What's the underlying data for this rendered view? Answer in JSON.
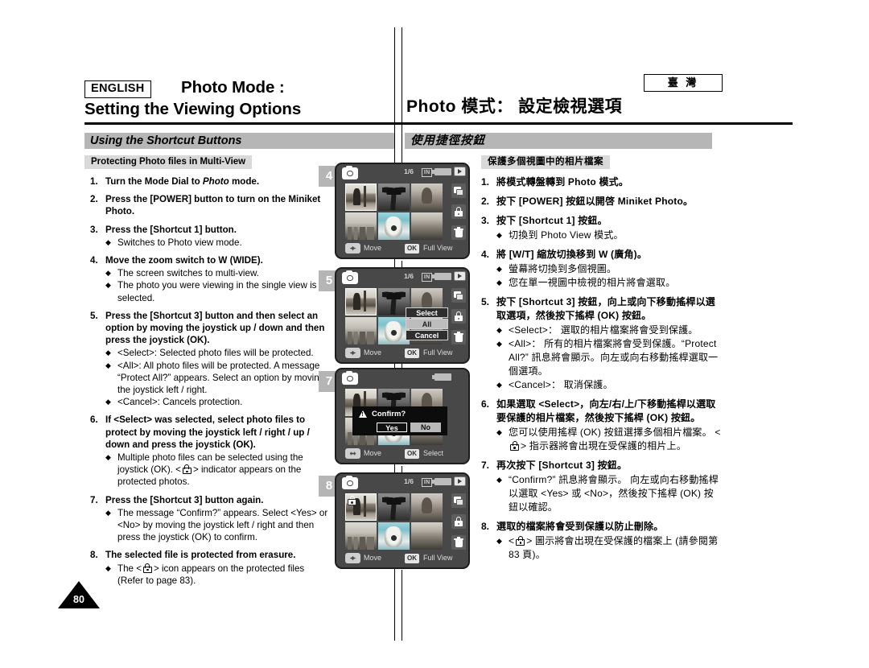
{
  "header": {
    "language_badge": "ENGLISH",
    "title_en_line1": "Photo Mode :",
    "title_en_line2": "Setting the Viewing Options",
    "title_cn": "Photo 模式： 設定檢視選項",
    "region_badge": "臺 灣"
  },
  "section": {
    "band_en": "Using the Shortcut Buttons",
    "band_cn": "使用捷徑按鈕",
    "chip_en": "Protecting Photo files in Multi-View",
    "chip_cn": "保護多個視圖中的相片檔案"
  },
  "steps_en": [
    {
      "num": "1.",
      "text": "Turn the Mode Dial to Photo mode.",
      "text_pre": "Turn the Mode Dial to ",
      "text_em": "Photo",
      "text_post": " mode.",
      "bullets": []
    },
    {
      "num": "2.",
      "text": "Press the [POWER] button to turn on the Miniket Photo.",
      "bullets": []
    },
    {
      "num": "3.",
      "text": "Press the [Shortcut 1] button.",
      "bullets": [
        "Switches to Photo view mode."
      ]
    },
    {
      "num": "4.",
      "text": "Move the zoom switch to W (WIDE).",
      "bullets": [
        "The screen switches to multi-view.",
        "The photo you were viewing in the single view is selected."
      ]
    },
    {
      "num": "5.",
      "text": "Press the [Shortcut 3] button and then select an option by moving the joystick up / down and then press the joystick (OK).",
      "bullets": [
        "<Select>: Selected photo files will be protected.",
        "<All>: All photo files will be protected. A message “Protect All?” appears. Select an option by moving the joystick left / right.",
        "<Cancel>: Cancels protection."
      ]
    },
    {
      "num": "6.",
      "text": "If <Select> was selected, select photo files to protect by moving the joystick left / right / up / down and press the joystick (OK).",
      "bullets": [
        "Multiple photo files can be selected using the joystick (OK). <  > indicator appears on the protected photos."
      ]
    },
    {
      "num": "7.",
      "text": "Press the [Shortcut 3] button again.",
      "bullets": [
        "The message “Confirm?” appears. Select <Yes> or <No> by moving the joystick left / right and then press the joystick (OK) to confirm."
      ]
    },
    {
      "num": "8.",
      "text": "The selected file is protected from erasure.",
      "bullets": [
        "The <  > icon appears on the protected files (Refer to page 83)."
      ]
    }
  ],
  "steps_cn": [
    {
      "num": "1.",
      "text": "將模式轉盤轉到 Photo 模式。",
      "bullets": []
    },
    {
      "num": "2.",
      "text": "按下 [POWER] 按鈕以開啓 Miniket Photo。",
      "bullets": []
    },
    {
      "num": "3.",
      "text": "按下 [Shortcut 1] 按鈕。",
      "bullets": [
        "切換到 Photo View 模式。"
      ]
    },
    {
      "num": "4.",
      "text": "將 [W/T] 縮放切換移到 W (廣角)。",
      "bullets": [
        "螢幕將切換到多個視圖。",
        "您在單一視圖中檢視的相片將會選取。"
      ]
    },
    {
      "num": "5.",
      "text": "按下 [Shortcut 3] 按鈕，向上或向下移動搖桿以選取選項，然後按下搖桿 (OK) 按鈕。",
      "bullets": [
        "<Select>： 選取的相片檔案將會受到保護。",
        "<All>： 所有的相片檔案將會受到保護。“Protect All?” 訊息將會顯示。向左或向右移動搖桿選取一個選項。",
        "<Cancel>： 取消保護。"
      ]
    },
    {
      "num": "6.",
      "text": "如果選取 <Select>，向左/右/上/下移動搖桿以選取要保護的相片檔案，然後按下搖桿 (OK) 按鈕。",
      "bullets": [
        "您可以使用搖桿 (OK) 按鈕選擇多個相片檔案。<  > 指示器將會出現在受保護的相片上。"
      ]
    },
    {
      "num": "7.",
      "text": "再次按下 [Shortcut 3] 按鈕。",
      "bullets": [
        "“Confirm?” 訊息將會顯示。 向左或向右移動搖桿以選取 <Yes> 或 <No>，然後按下搖桿 (OK) 按鈕以確認。"
      ]
    },
    {
      "num": "8.",
      "text": "選取的檔案將會受到保護以防止刪除。",
      "bullets": [
        "<  > 圖示將會出現在受保護的檔案上 (請參閱第 83 頁)。"
      ]
    }
  ],
  "screens": [
    {
      "tag": "4",
      "counter": "1/6",
      "memory": "IN",
      "bottom_move": "Move",
      "bottom_ok_badge": "OK",
      "bottom_ok_label": "Full View"
    },
    {
      "tag": "5",
      "counter": "1/6",
      "memory": "IN",
      "bottom_move": "Move",
      "bottom_ok_badge": "OK",
      "bottom_ok_label": "Full View",
      "menu": [
        "Select",
        "All",
        "Cancel"
      ],
      "menu_highlight": "All"
    },
    {
      "tag": "7",
      "counter": "",
      "memory": "",
      "bottom_move": "Move",
      "bottom_ok_badge": "OK",
      "bottom_ok_label": "Select",
      "dialog_title": "Confirm?",
      "dialog_yes": "Yes",
      "dialog_no": "No"
    },
    {
      "tag": "8",
      "counter": "1/6",
      "memory": "IN",
      "bottom_move": "Move",
      "bottom_ok_badge": "OK",
      "bottom_ok_label": "Full View"
    }
  ],
  "page_number": "80",
  "colors": {
    "band_grey": "#b6b6b6",
    "chip_grey": "#d9d9d9",
    "lcd_bg": "#484848",
    "tag_grey": "#b5b5b5"
  }
}
